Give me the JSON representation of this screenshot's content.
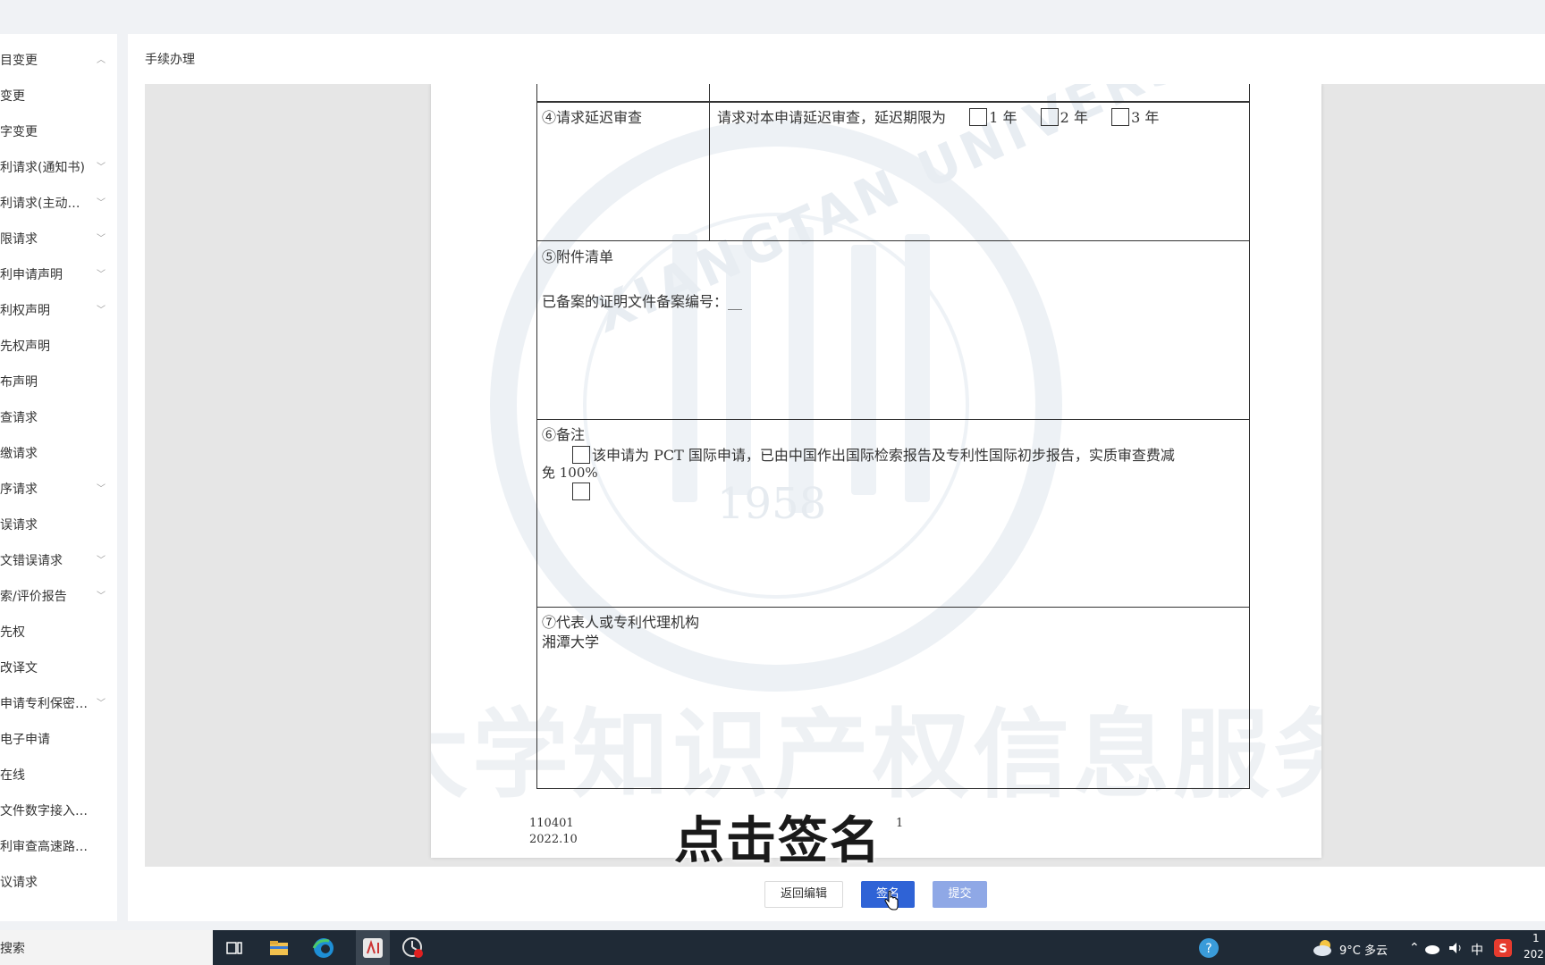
{
  "main": {
    "title": "手续办理"
  },
  "sidebar": {
    "items": [
      {
        "label": "目变更",
        "chevron": "up"
      },
      {
        "label": "变更",
        "chevron": ""
      },
      {
        "label": "字变更",
        "chevron": ""
      },
      {
        "label": "利请求(通知书)",
        "chevron": "down"
      },
      {
        "label": "利请求(主动…",
        "chevron": "down"
      },
      {
        "label": "限请求",
        "chevron": "down"
      },
      {
        "label": "利申请声明",
        "chevron": "down"
      },
      {
        "label": "利权声明",
        "chevron": "down"
      },
      {
        "label": "先权声明",
        "chevron": ""
      },
      {
        "label": "布声明",
        "chevron": ""
      },
      {
        "label": "查请求",
        "chevron": ""
      },
      {
        "label": "缴请求",
        "chevron": ""
      },
      {
        "label": "序请求",
        "chevron": "down"
      },
      {
        "label": "误请求",
        "chevron": ""
      },
      {
        "label": "文错误请求",
        "chevron": "down"
      },
      {
        "label": "索/评价报告",
        "chevron": "down"
      },
      {
        "label": "先权",
        "chevron": ""
      },
      {
        "label": "改译文",
        "chevron": ""
      },
      {
        "label": "申请专利保密…",
        "chevron": "down"
      },
      {
        "label": "电子申请",
        "chevron": ""
      },
      {
        "label": "在线",
        "chevron": ""
      },
      {
        "label": "文件数字接入…",
        "chevron": ""
      },
      {
        "label": "利审查高速路…",
        "chevron": ""
      },
      {
        "label": "议请求",
        "chevron": ""
      }
    ]
  },
  "document": {
    "section4": {
      "heading": "④请求延迟审查",
      "text": "请求对本申请延迟审查，延迟期限为",
      "options": [
        "1 年",
        "2 年",
        "3 年"
      ]
    },
    "section5": {
      "heading": "⑤附件清单",
      "text": "已备案的证明文件备案编号：__"
    },
    "section6": {
      "heading": "⑥备注",
      "line1": "该申请为 PCT 国际申请，已由中国作出国际检索报告及专利性国际初步报告，实质审查费减",
      "line2": "免 100%"
    },
    "section7": {
      "heading": "⑦代表人或专利代理机构",
      "value": "湘潭大学"
    },
    "footer": {
      "code": "110401",
      "date": "2022.10",
      "page": "1"
    },
    "watermark": {
      "arc_text": "XIANGTAN UNIVERSITY",
      "year": "1958",
      "banner": "湘潭大学知识产权信息服务中心"
    }
  },
  "caption": "点击签名",
  "buttons": {
    "back": "返回编辑",
    "sign": "签名",
    "submit": "提交"
  },
  "taskbar": {
    "search_label": "搜索",
    "weather": "9°C  多云",
    "ime": "中",
    "clock_time": "1",
    "clock_date": "202"
  }
}
